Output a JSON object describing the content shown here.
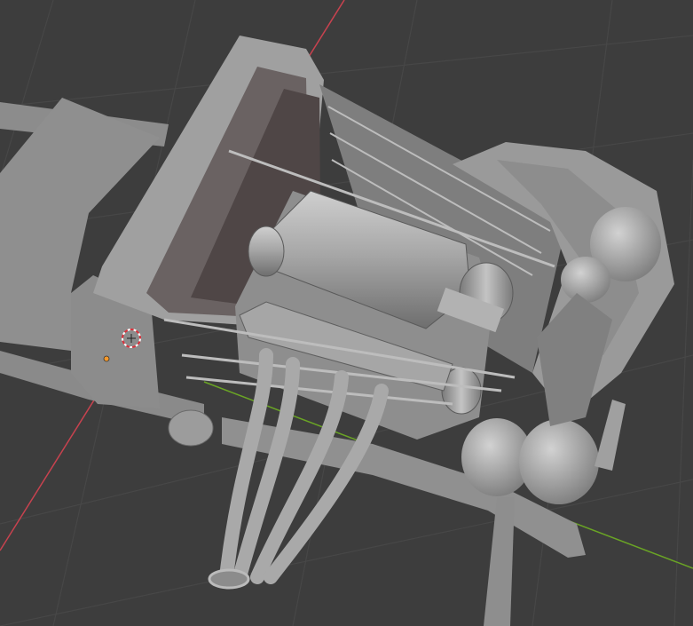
{
  "viewport": {
    "background": "#3d3d3d",
    "grid_color": "#474747",
    "x_axis_color": "#c8424f",
    "y_axis_color": "#6aa425",
    "model_color": "#9a9a9a",
    "origin_color": "#f6982a",
    "cursor_colors": [
      "#ffffff",
      "#d8303a"
    ]
  },
  "icons": {
    "cursor": "3d-cursor-icon",
    "origin": "object-origin-icon"
  }
}
